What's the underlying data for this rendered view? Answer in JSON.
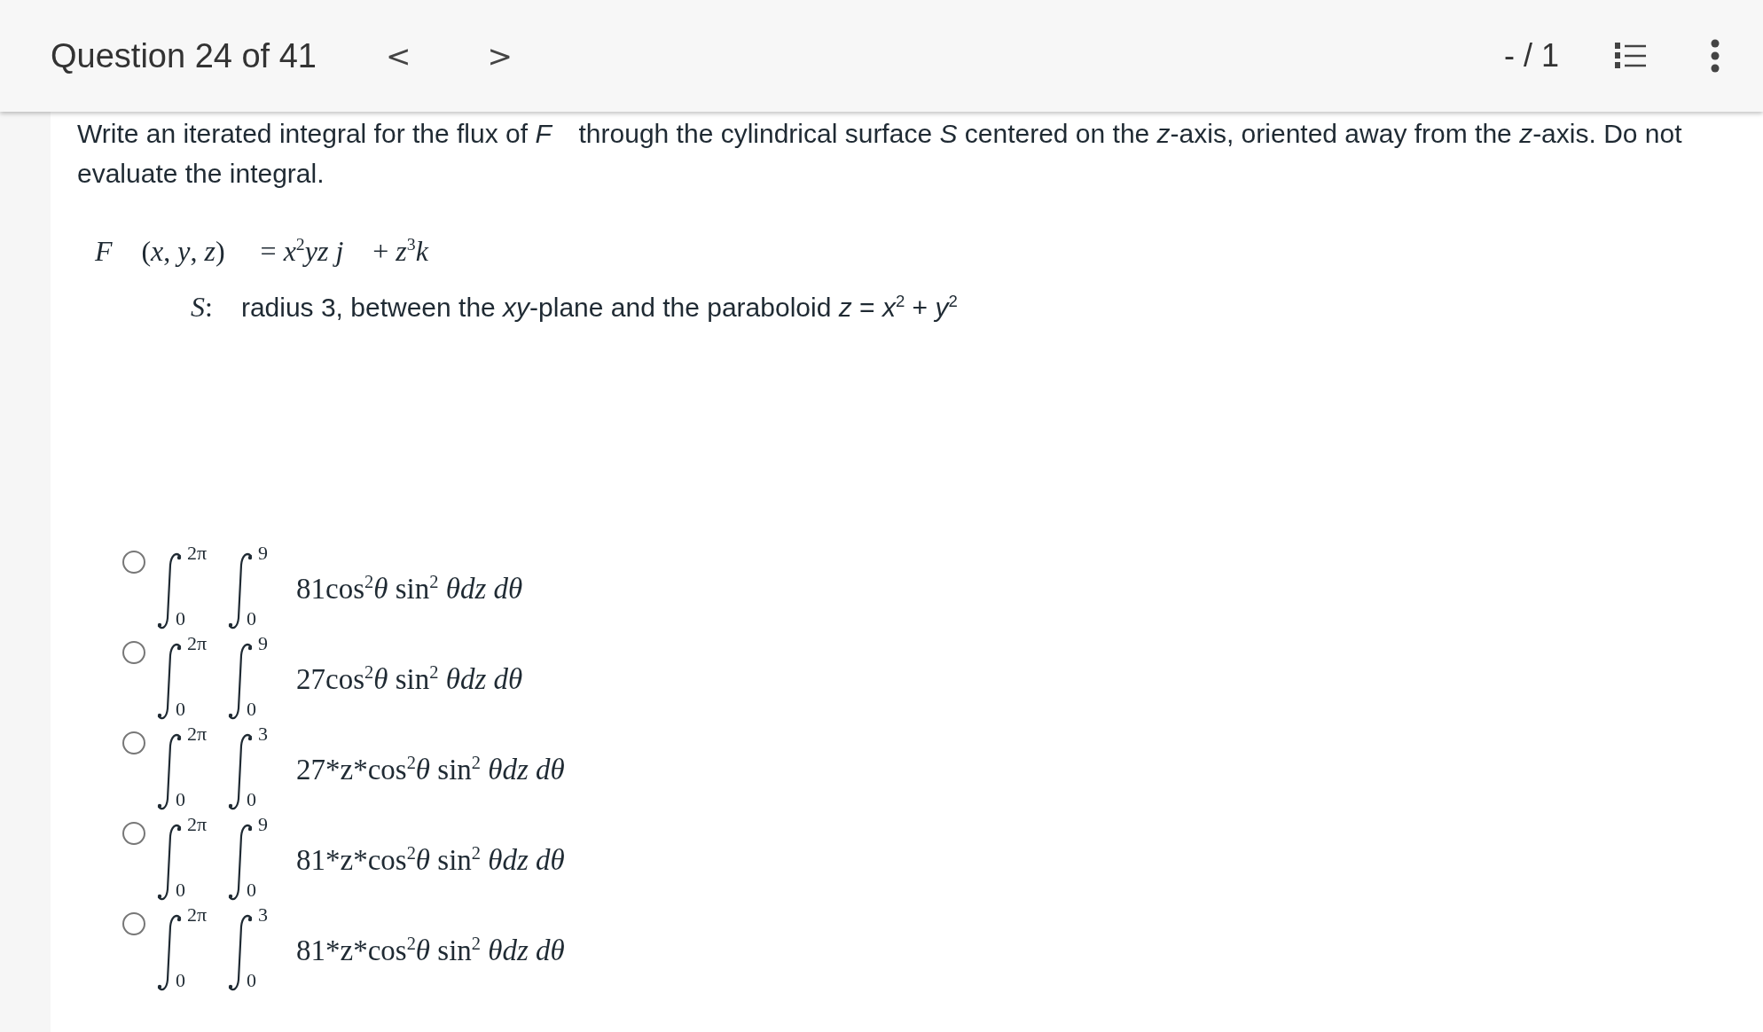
{
  "header": {
    "title": "Question 24 of 41",
    "prev": "<",
    "next": ">",
    "score": "- / 1"
  },
  "question": {
    "text": "Write an iterated integral for the flux of *F⃗* through the cylindrical surface *S* centered on the *z*-axis, oriented away from the *z*-axis. Do not evaluate the integral."
  },
  "field": {
    "lhs": "*F⃗* (*x*, *y*, *z*)",
    "rhs": "= *x*$^{2}$*yz* *j⃗* + *z*$^{3}$*k⃗*"
  },
  "surface": {
    "label": "*S*:",
    "text": "radius 3, between the *xy*-plane and the paraboloid *z* = *x*$^{2}$ + *y*$^{2}$"
  },
  "options": [
    {
      "selected": false,
      "outer_upper": "2π",
      "outer_lower": "0",
      "inner_upper": "9",
      "inner_lower": "0",
      "integrand": "81cos$^{2}$*θ* sin$^{2}$ *θdz dθ*"
    },
    {
      "selected": false,
      "outer_upper": "2π",
      "outer_lower": "0",
      "inner_upper": "9",
      "inner_lower": "0",
      "integrand": "27cos$^{2}$*θ* sin$^{2}$ *θdz dθ*"
    },
    {
      "selected": false,
      "outer_upper": "2π",
      "outer_lower": "0",
      "inner_upper": "3",
      "inner_lower": "0",
      "coefficient": "27",
      "integrand": "*z*cos$^{2}$*θ* sin$^{2}$ *θdz dθ*"
    },
    {
      "selected": false,
      "outer_upper": "2π",
      "outer_lower": "0",
      "inner_upper": "9",
      "inner_lower": "0",
      "coefficient": "81",
      "integrand": "*z*cos$^{2}$*θ* sin$^{2}$ *θdz dθ*"
    },
    {
      "selected": false,
      "outer_upper": "2π",
      "outer_lower": "0",
      "inner_upper": "3",
      "inner_lower": "0",
      "coefficient": "81",
      "integrand": "*z*cos$^{2}$*θ* sin$^{2}$ *θdz dθ*"
    }
  ]
}
